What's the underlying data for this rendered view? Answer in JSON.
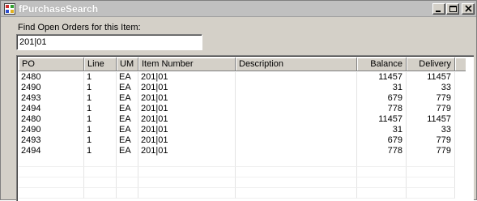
{
  "window": {
    "title": "fPurchaseSearch"
  },
  "search": {
    "label": "Find Open Orders for this Item:",
    "value": "201|01"
  },
  "grid": {
    "columns": [
      "PO",
      "Line",
      "UM",
      "Item Number",
      "Description",
      "Balance",
      "Delivery"
    ],
    "rows": [
      [
        "2480",
        "1",
        "EA",
        "201|01",
        "",
        "11457",
        "11457"
      ],
      [
        "2490",
        "1",
        "EA",
        "201|01",
        "",
        "31",
        "33"
      ],
      [
        "2493",
        "1",
        "EA",
        "201|01",
        "",
        "679",
        "779"
      ],
      [
        "2494",
        "1",
        "EA",
        "201|01",
        "",
        "778",
        "779"
      ],
      [
        "2480",
        "1",
        "EA",
        "201|01",
        "",
        "11457",
        "11457"
      ],
      [
        "2490",
        "1",
        "EA",
        "201|01",
        "",
        "31",
        "33"
      ],
      [
        "2493",
        "1",
        "EA",
        "201|01",
        "",
        "679",
        "779"
      ],
      [
        "2494",
        "1",
        "EA",
        "201|01",
        "",
        "778",
        "779"
      ]
    ]
  },
  "icons": {
    "app": "app-icon",
    "minimize": "minimize-icon",
    "maximize": "maximize-icon",
    "close": "close-icon"
  }
}
